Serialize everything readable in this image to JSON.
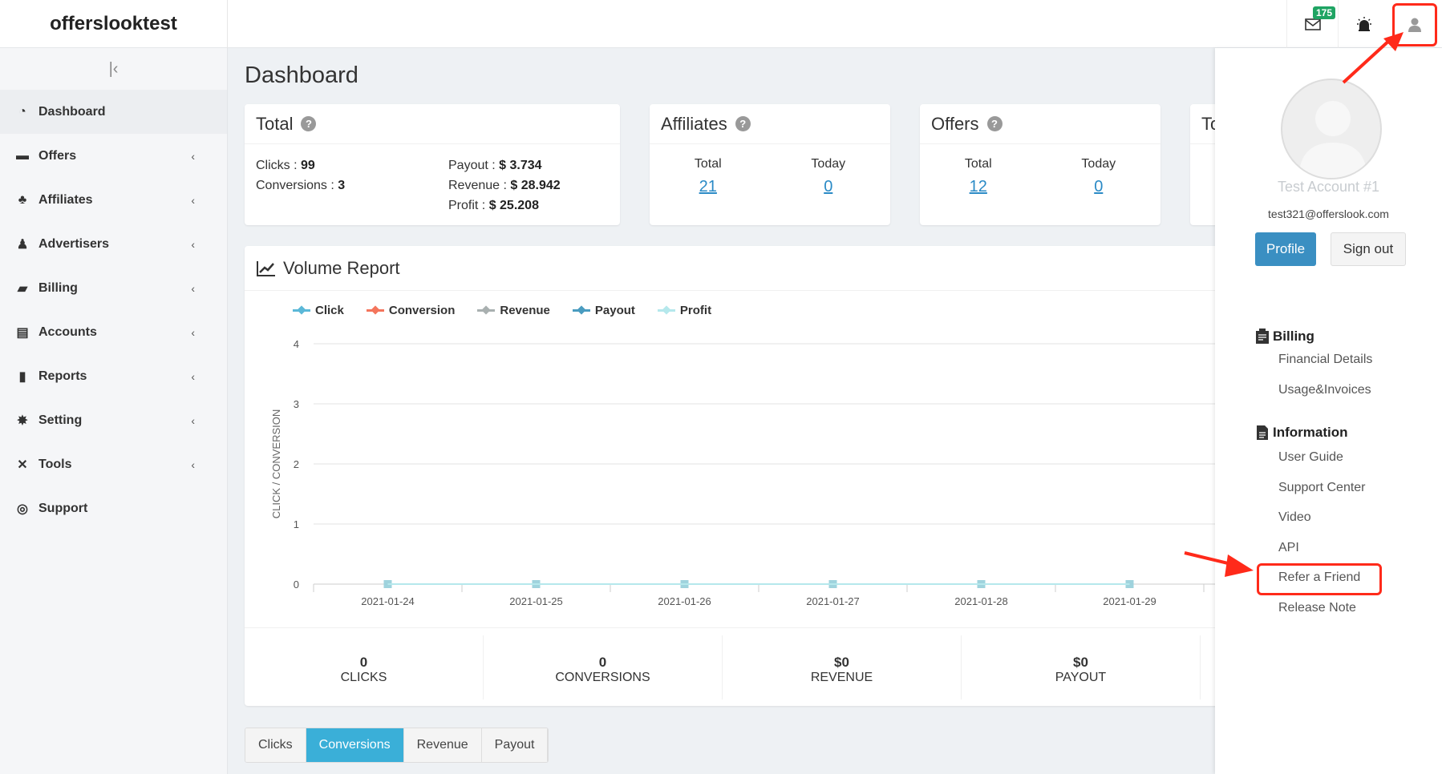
{
  "brand": "offerslooktest",
  "header": {
    "mail_badge": "175",
    "icons": [
      "mail-icon",
      "alarm-icon",
      "user-icon"
    ]
  },
  "sidebar": {
    "items": [
      {
        "label": "Dashboard",
        "icon": "dashboard-icon",
        "active": true
      },
      {
        "label": "Offers",
        "icon": "folder-icon"
      },
      {
        "label": "Affiliates",
        "icon": "sitemap-icon"
      },
      {
        "label": "Advertisers",
        "icon": "advertiser-icon"
      },
      {
        "label": "Billing",
        "icon": "book-icon"
      },
      {
        "label": "Accounts",
        "icon": "id-card-icon"
      },
      {
        "label": "Reports",
        "icon": "bar-chart-icon"
      },
      {
        "label": "Setting",
        "icon": "gear-icon"
      },
      {
        "label": "Tools",
        "icon": "tools-icon"
      },
      {
        "label": "Support",
        "icon": "lifebuoy-icon"
      }
    ]
  },
  "main": {
    "title": "Dashboard",
    "total": {
      "title": "Total",
      "clicks_label": "Clicks : ",
      "clicks": "99",
      "conversions_label": "Conversions : ",
      "conversions": "3",
      "payout_label": "Payout : ",
      "payout": "$ 3.734",
      "revenue_label": "Revenue : ",
      "revenue": "$ 28.942",
      "profit_label": "Profit : ",
      "profit": "$ 25.208"
    },
    "affiliates": {
      "title": "Affiliates",
      "total_label": "Total",
      "total": "21",
      "today_label": "Today",
      "today": "0"
    },
    "offers": {
      "title": "Offers",
      "total_label": "Total",
      "total": "12",
      "today_label": "Today",
      "today": "0"
    },
    "fourth_card_title": "To",
    "volume_report": {
      "title": "Volume Report",
      "summary": [
        {
          "value": "0",
          "label": "CLICKS"
        },
        {
          "value": "0",
          "label": "CONVERSIONS"
        },
        {
          "value": "$0",
          "label": "REVENUE"
        },
        {
          "value": "$0",
          "label": "PAYOUT"
        }
      ]
    },
    "tabs": [
      {
        "label": "Clicks"
      },
      {
        "label": "Conversions",
        "active": true
      },
      {
        "label": "Revenue"
      },
      {
        "label": "Payout"
      }
    ]
  },
  "chart_data": {
    "type": "line",
    "title": "",
    "xlabel": "",
    "ylabel": "CLICK / CONVERSION",
    "x": [
      "2021-01-24",
      "2021-01-25",
      "2021-01-26",
      "2021-01-27",
      "2021-01-28",
      "2021-01-29"
    ],
    "ylim": [
      0,
      4
    ],
    "yticks": [
      "0",
      "1",
      "2",
      "3",
      "4"
    ],
    "grid": true,
    "legend_position": "top-left",
    "series": [
      {
        "name": "Click",
        "color": "#5bb8d8",
        "values": [
          0,
          0,
          0,
          0,
          0,
          0
        ]
      },
      {
        "name": "Conversion",
        "color": "#f4755c",
        "values": [
          0,
          0,
          0,
          0,
          0,
          0
        ]
      },
      {
        "name": "Revenue",
        "color": "#a9b0b0",
        "values": [
          0,
          0,
          0,
          0,
          0,
          0
        ]
      },
      {
        "name": "Payout",
        "color": "#4a9cc0",
        "values": [
          0,
          0,
          0,
          0,
          0,
          0
        ]
      },
      {
        "name": "Profit",
        "color": "#b5e8ec",
        "values": [
          0,
          0,
          0,
          0,
          0,
          0
        ]
      }
    ]
  },
  "user_panel": {
    "name": "Test Account #1",
    "email": "test321@offerslook.com",
    "profile_btn": "Profile",
    "signout_btn": "Sign out",
    "billing": {
      "title": "Billing",
      "links": [
        "Financial Details",
        "Usage&Invoices"
      ]
    },
    "information": {
      "title": "Information",
      "links": [
        "User Guide",
        "Support Center",
        "Video",
        "API",
        "Refer a Friend",
        "Release Note"
      ]
    }
  },
  "annotation_color": "#ff2a1a"
}
